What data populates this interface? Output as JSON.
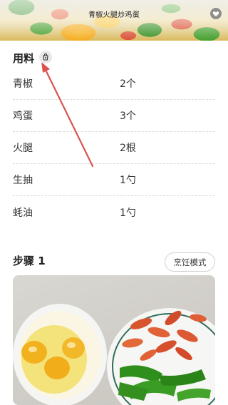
{
  "header": {
    "title": "青椒火腿炒鸡蛋",
    "favorite_icon": "heart-icon"
  },
  "ingredients": {
    "title": "用料",
    "icon": "shopping-list-icon",
    "items": [
      {
        "name": "青椒",
        "qty": "2个"
      },
      {
        "name": "鸡蛋",
        "qty": "3个"
      },
      {
        "name": "火腿",
        "qty": "2根"
      },
      {
        "name": "生抽",
        "qty": "1勺"
      },
      {
        "name": "蚝油",
        "qty": "1勺"
      }
    ]
  },
  "steps": {
    "title": "步骤 1",
    "cook_mode_label": "烹饪模式"
  },
  "colors": {
    "accent_arrow": "#d9534f",
    "divider": "#dcdcdc"
  }
}
